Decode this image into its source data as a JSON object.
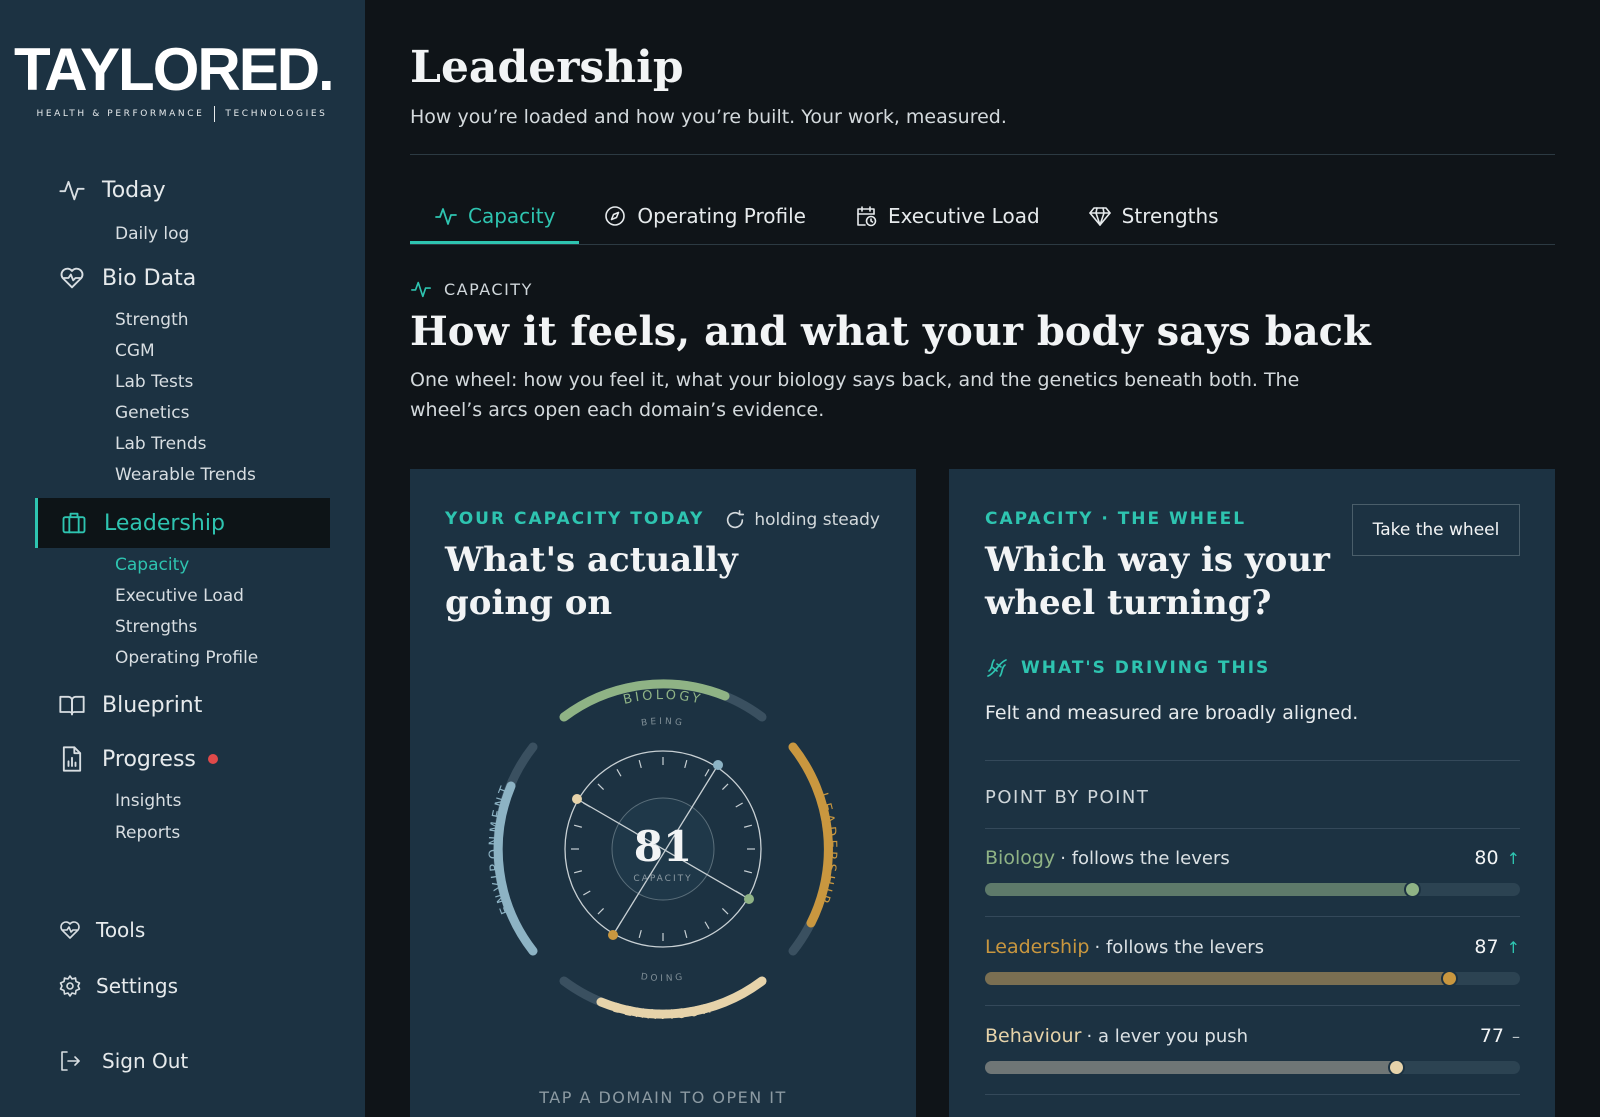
{
  "brand": {
    "name": "TAYLORED.",
    "tagline_left": "HEALTH & PERFORMANCE",
    "tagline_right": "TECHNOLOGIES"
  },
  "nav": {
    "today": "Today",
    "daily_log": "Daily log",
    "bio_data": "Bio Data",
    "bio_sub": [
      "Strength",
      "CGM",
      "Lab Tests",
      "Genetics",
      "Lab Trends",
      "Wearable Trends"
    ],
    "leadership": "Leadership",
    "leadership_sub": [
      "Capacity",
      "Executive Load",
      "Strengths",
      "Operating Profile"
    ],
    "blueprint": "Blueprint",
    "progress": "Progress",
    "progress_sub": [
      "Insights",
      "Reports"
    ],
    "tools": "Tools",
    "settings": "Settings",
    "sign_out": "Sign Out"
  },
  "header": {
    "title": "Leadership",
    "subtitle": "How you’re loaded and how you’re built. Your work, measured."
  },
  "tabs": [
    "Capacity",
    "Operating Profile",
    "Executive Load",
    "Strengths"
  ],
  "section": {
    "eyebrow": "CAPACITY",
    "title": "How it feels, and what your body says back",
    "description": "One wheel: how you feel it, what your biology says back, and the genetics beneath both. The wheel’s arcs open each domain’s evidence."
  },
  "left_card": {
    "eyebrow": "YOUR CAPACITY TODAY",
    "status": "holding steady",
    "heading_line1": "What's actually",
    "heading_line2": "going on",
    "wheel": {
      "score": "81",
      "score_label": "CAPACITY",
      "domain_top": "BIOLOGY",
      "domain_bottom": "BEHAVIOUR",
      "domain_left": "ENVIRONMENT",
      "domain_right": "LEADERSHIP",
      "inner_top": "BEING",
      "inner_bottom": "DOING"
    },
    "hint": "TAP A DOMAIN TO OPEN IT"
  },
  "right_card": {
    "eyebrow": "CAPACITY · THE WHEEL",
    "heading_line1": "Which way is your",
    "heading_line2": "wheel turning?",
    "button": "Take the wheel",
    "driving_label": "WHAT'S DRIVING THIS",
    "driving_text": "Felt and measured are broadly aligned.",
    "pbp_label": "POINT BY POINT",
    "metrics": [
      {
        "name": "Biology",
        "tag": "· follows the levers",
        "value": "80",
        "trend": "↑",
        "level": 0.8,
        "color": "#8fb385",
        "fill": "#5e7a6a"
      },
      {
        "name": "Leadership",
        "tag": "· follows the levers",
        "value": "87",
        "trend": "↑",
        "level": 0.87,
        "color": "#c9973f",
        "fill": "#7a6f52"
      },
      {
        "name": "Behaviour",
        "tag": "· a lever you push",
        "value": "77",
        "trend": "–",
        "level": 0.77,
        "color": "#e6d3aa",
        "fill": "#6f7676"
      }
    ]
  }
}
